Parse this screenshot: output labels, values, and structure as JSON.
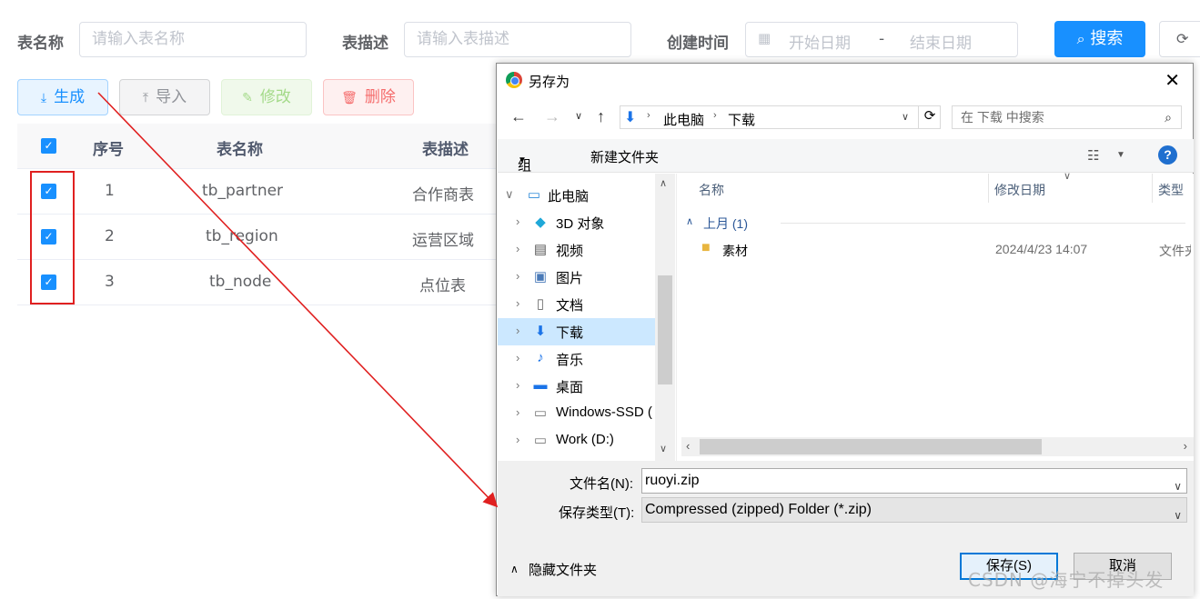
{
  "filters": {
    "table_name_label": "表名称",
    "table_name_placeholder": "请输入表名称",
    "table_desc_label": "表描述",
    "table_desc_placeholder": "请输入表描述",
    "created_time_label": "创建时间",
    "start_date_placeholder": "开始日期",
    "date_sep": "-",
    "end_date_placeholder": "结束日期",
    "search_label": "搜索"
  },
  "toolbar": {
    "generate": "生成",
    "import": "导入",
    "modify": "修改",
    "delete": "删除"
  },
  "table": {
    "headers": {
      "index": "序号",
      "name": "表名称",
      "desc": "表描述"
    },
    "rows": [
      {
        "index": "1",
        "name": "tb_partner",
        "desc": "合作商表"
      },
      {
        "index": "2",
        "name": "tb_region",
        "desc": "运营区域"
      },
      {
        "index": "3",
        "name": "tb_node",
        "desc": "点位表"
      }
    ]
  },
  "dialog": {
    "title": "另存为",
    "breadcrumb": [
      "此电脑",
      "下载"
    ],
    "search_placeholder": "在 下载 中搜索",
    "organize": "组织",
    "new_folder": "新建文件夹",
    "tree": [
      {
        "label": "此电脑",
        "icon": "pc-icon",
        "expanded": true
      },
      {
        "label": "3D 对象",
        "icon": "cube-icon"
      },
      {
        "label": "视频",
        "icon": "video-icon"
      },
      {
        "label": "图片",
        "icon": "picture-icon"
      },
      {
        "label": "文档",
        "icon": "document-icon"
      },
      {
        "label": "下载",
        "icon": "download-icon",
        "selected": true
      },
      {
        "label": "音乐",
        "icon": "music-icon"
      },
      {
        "label": "桌面",
        "icon": "desktop-icon"
      },
      {
        "label": "Windows-SSD (",
        "icon": "drive-icon"
      },
      {
        "label": "Work (D:)",
        "icon": "drive-icon"
      }
    ],
    "columns": {
      "name": "名称",
      "modified": "修改日期",
      "type": "类型"
    },
    "group_label": "上月 (1)",
    "files": [
      {
        "name": "素材",
        "modified": "2024/4/23 14:07",
        "type": "文件夹"
      }
    ],
    "filename_label": "文件名(N):",
    "filename_value": "ruoyi.zip",
    "filetype_label": "保存类型(T):",
    "filetype_value": "Compressed (zipped) Folder (*.zip)",
    "hide_folders": "隐藏文件夹",
    "save": "保存(S)",
    "cancel": "取消"
  },
  "watermark": "CSDN @海宁不掉头发",
  "colors": {
    "primary": "#1890ff",
    "annotation": "#e02020",
    "selected_tree": "#cce8ff"
  }
}
